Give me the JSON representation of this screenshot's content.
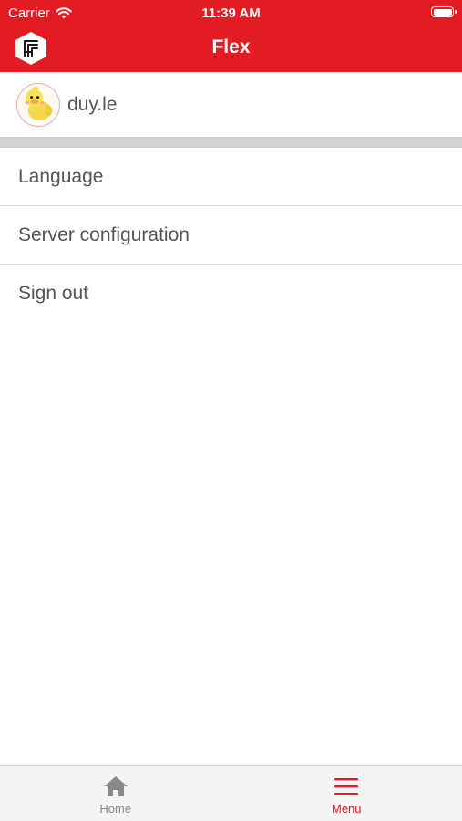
{
  "status_bar": {
    "carrier": "Carrier",
    "time": "11:39 AM",
    "wifi_icon": "wifi-icon",
    "battery_icon": "battery-icon"
  },
  "header": {
    "title": "Flex",
    "logo_icon": "flex-logo-icon",
    "background_color": "#e31b23"
  },
  "profile": {
    "username": "duy.le",
    "avatar_icon": "duck-avatar"
  },
  "menu": {
    "items": [
      {
        "label": "Language"
      },
      {
        "label": "Server configuration"
      },
      {
        "label": "Sign out"
      }
    ]
  },
  "tab_bar": {
    "tabs": [
      {
        "label": "Home",
        "icon": "home-icon",
        "active": false
      },
      {
        "label": "Menu",
        "icon": "hamburger-icon",
        "active": true
      }
    ],
    "active_color": "#e31b23",
    "inactive_color": "#8a8a8a"
  }
}
